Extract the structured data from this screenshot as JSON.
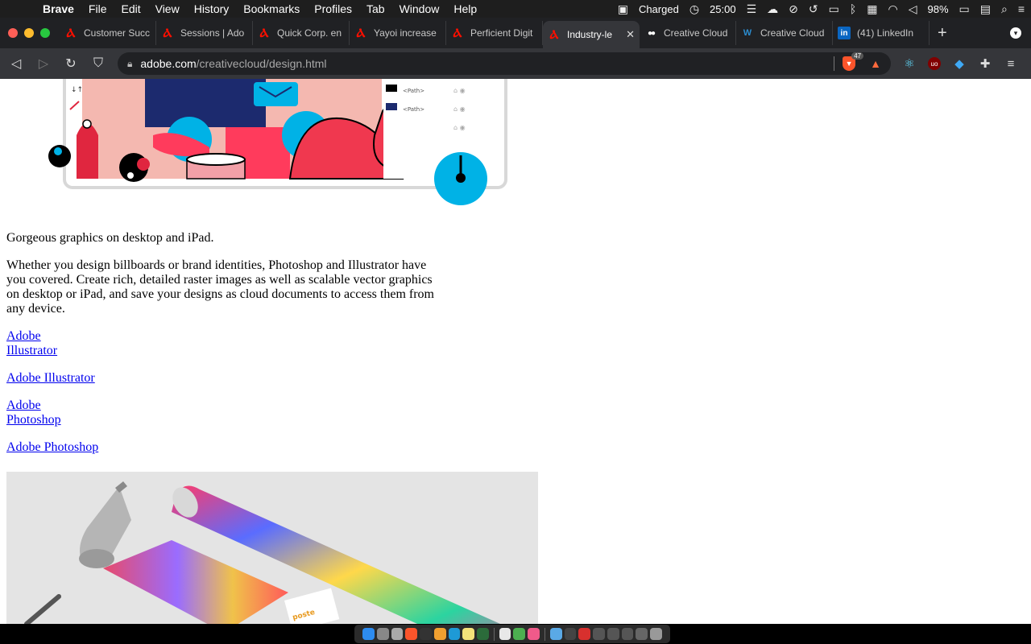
{
  "menubar": {
    "apple_icon": "apple-logo-icon",
    "app_name": "Brave",
    "items": [
      "File",
      "Edit",
      "View",
      "History",
      "Bookmarks",
      "Profiles",
      "Tab",
      "Window",
      "Help"
    ],
    "battery_status": "Charged",
    "timer": "25:00",
    "battery_percent": "98%"
  },
  "tabs": [
    {
      "title": "Customer Succ",
      "favicon": "adobe-icon",
      "active": false
    },
    {
      "title": "Sessions | Ado",
      "favicon": "adobe-icon",
      "active": false
    },
    {
      "title": "Quick Corp. en",
      "favicon": "adobe-icon",
      "active": false
    },
    {
      "title": "Yayoi increase",
      "favicon": "adobe-icon",
      "active": false
    },
    {
      "title": "Perficient Digit",
      "favicon": "adobe-icon",
      "active": false
    },
    {
      "title": "Industry-le",
      "favicon": "adobe-icon",
      "active": true
    },
    {
      "title": "Creative Cloud",
      "favicon": "medium-icon",
      "active": false
    },
    {
      "title": "Creative Cloud",
      "favicon": "wp-icon",
      "active": false
    },
    {
      "title": "(41) LinkedIn",
      "favicon": "linkedin-icon",
      "active": false
    }
  ],
  "toolbar": {
    "url_host": "adobe.com",
    "url_path": "/creativecloud/design.html",
    "shield_count": "47"
  },
  "page": {
    "headline": "Gorgeous graphics on desktop and iPad.",
    "description": "Whether you design billboards or brand identities, Photoshop and Illustrator have you covered. Create rich, detailed raster images as well as scalable vector graphics on desktop or iPad, and save your designs as cloud documents to access them from any device.",
    "illustrator_img_alt": "Adobe Illustrator",
    "illustrator_link": "Adobe Illustrator",
    "photoshop_img_alt": "Adobe Photoshop",
    "photoshop_link": "Adobe Photoshop",
    "layer_labels": [
      "<Path>",
      "<Path>"
    ]
  },
  "colors": {
    "adobe_red": "#fa0f00",
    "link_blue": "#0000ee",
    "illustration_coral": "#f0384f",
    "illustration_cyan": "#00b2e6"
  }
}
